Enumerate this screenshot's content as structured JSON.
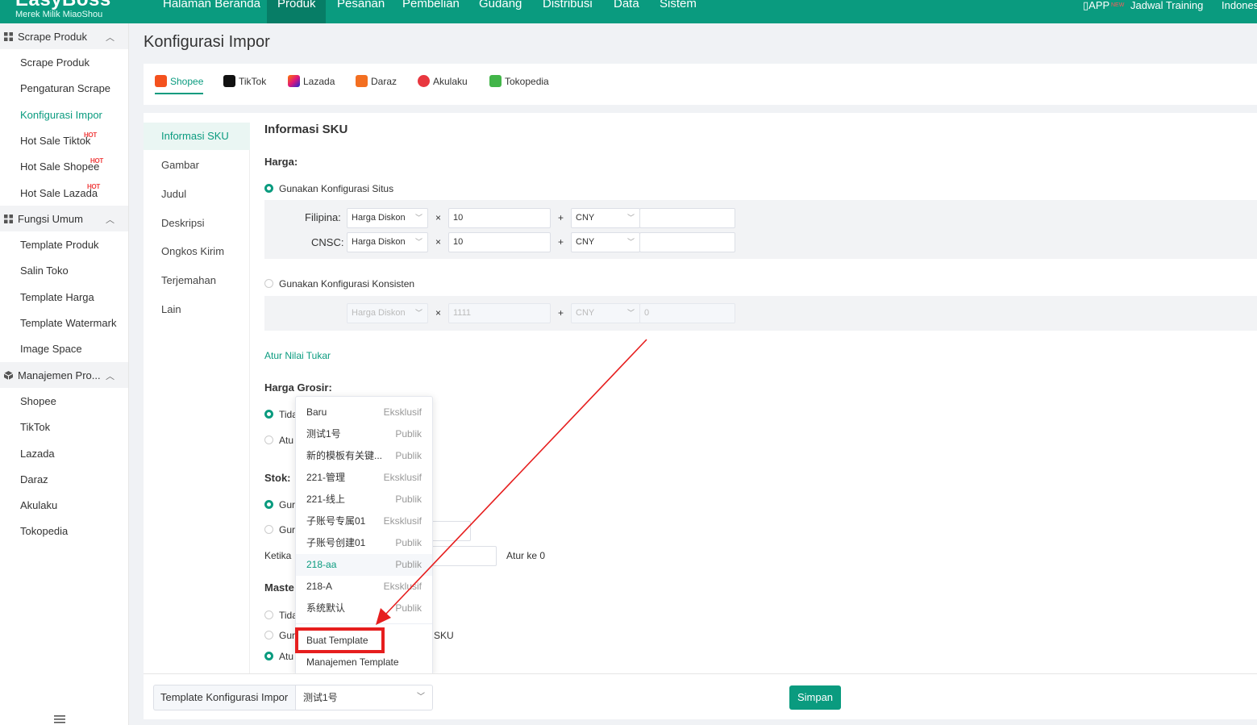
{
  "brand": {
    "name": "EasyBoss",
    "subtitle": "Merek Milik MiaoShou"
  },
  "colors": {
    "accent": "#0a9b7f",
    "hot": "#f04040",
    "annotation": "#e61e1e"
  },
  "topnav": {
    "items": [
      "Halaman Beranda",
      "Produk",
      "Pesanan",
      "Pembelian",
      "Gudang",
      "Distribusi",
      "Data",
      "Sistem"
    ],
    "active_index": 1,
    "right": {
      "app": "APP",
      "app_badge": "NEW",
      "training": "Jadwal Training",
      "language": "Indonesia"
    }
  },
  "sidebar": {
    "hot_badge": "HOT",
    "groups": [
      {
        "label": "Scrape Produk",
        "items": [
          "Scrape Produk",
          "Pengaturan Scrape",
          "Konfigurasi Impor",
          "Hot Sale Tiktok",
          "Hot Sale Shopee",
          "Hot Sale Lazada"
        ]
      },
      {
        "label": "Fungsi Umum",
        "items": [
          "Template Produk",
          "Salin Toko",
          "Template Harga",
          "Template Watermark",
          "Image Space"
        ]
      },
      {
        "label": "Manajemen Pro...",
        "items": [
          "Shopee",
          "TikTok",
          "Lazada",
          "Daraz",
          "Akulaku",
          "Tokopedia"
        ]
      }
    ],
    "collapse_icon": "menu-icon"
  },
  "page": {
    "title": "Konfigurasi Impor"
  },
  "platform_tabs": [
    "Shopee",
    "TikTok",
    "Lazada",
    "Daraz",
    "Akulaku",
    "Tokopedia"
  ],
  "left_menu": [
    "Informasi SKU",
    "Gambar",
    "Judul",
    "Deskripsi",
    "Ongkos Kirim",
    "Terjemahan",
    "Lain"
  ],
  "form": {
    "section_title": "Informasi SKU",
    "price_label": "Harga:",
    "opt_site": "Gunakan Konfigurasi Situs",
    "rows": [
      {
        "label": "Filipina:",
        "base": "Harga Diskon",
        "multiply": "×",
        "factor": "10",
        "plus": "+",
        "currency": "CNY",
        "add": ""
      },
      {
        "label": "CNSC:",
        "base": "Harga Diskon",
        "multiply": "×",
        "factor": "10",
        "plus": "+",
        "currency": "CNY",
        "add": ""
      }
    ],
    "opt_consistent": "Gunakan Konfigurasi Konsisten",
    "consistent": {
      "base": "Harga Diskon",
      "multiply": "×",
      "factor": "1111",
      "plus": "+",
      "currency": "CNY",
      "add": "0"
    },
    "exchange_link": "Atur Nilai Tukar",
    "wholesale_label": "Harga Grosir:",
    "wholesale_opts": [
      "Tida",
      "Atu"
    ],
    "stock_label": "Stok:",
    "stock_opts": [
      "Gur",
      "Gur"
    ],
    "when_label": "Ketika",
    "when_suffix": "Atur ke 0",
    "master_label": "Maste",
    "master_opts": [
      "Tida",
      "Gur",
      "Atu"
    ],
    "master_sku_suffix": "SKU"
  },
  "dropdown": {
    "options": [
      {
        "name": "Baru",
        "type": "Eksklusif"
      },
      {
        "name": "测试1号",
        "type": "Publik"
      },
      {
        "name": "新的模板有关键...",
        "type": "Publik"
      },
      {
        "name": "221-管理",
        "type": "Eksklusif"
      },
      {
        "name": "221-线上",
        "type": "Publik"
      },
      {
        "name": "子账号专属01",
        "type": "Eksklusif"
      },
      {
        "name": "子账号创建01",
        "type": "Publik"
      },
      {
        "name": "218-aa",
        "type": "Publik"
      },
      {
        "name": "218-A",
        "type": "Eksklusif"
      },
      {
        "name": "系统默认",
        "type": "Publik"
      }
    ],
    "selected_index": 7,
    "create": "Buat Template",
    "manage": "Manajemen Template"
  },
  "bottom": {
    "template_label": "Template Konfigurasi Impor",
    "template_value": "测试1号",
    "save": "Simpan"
  }
}
